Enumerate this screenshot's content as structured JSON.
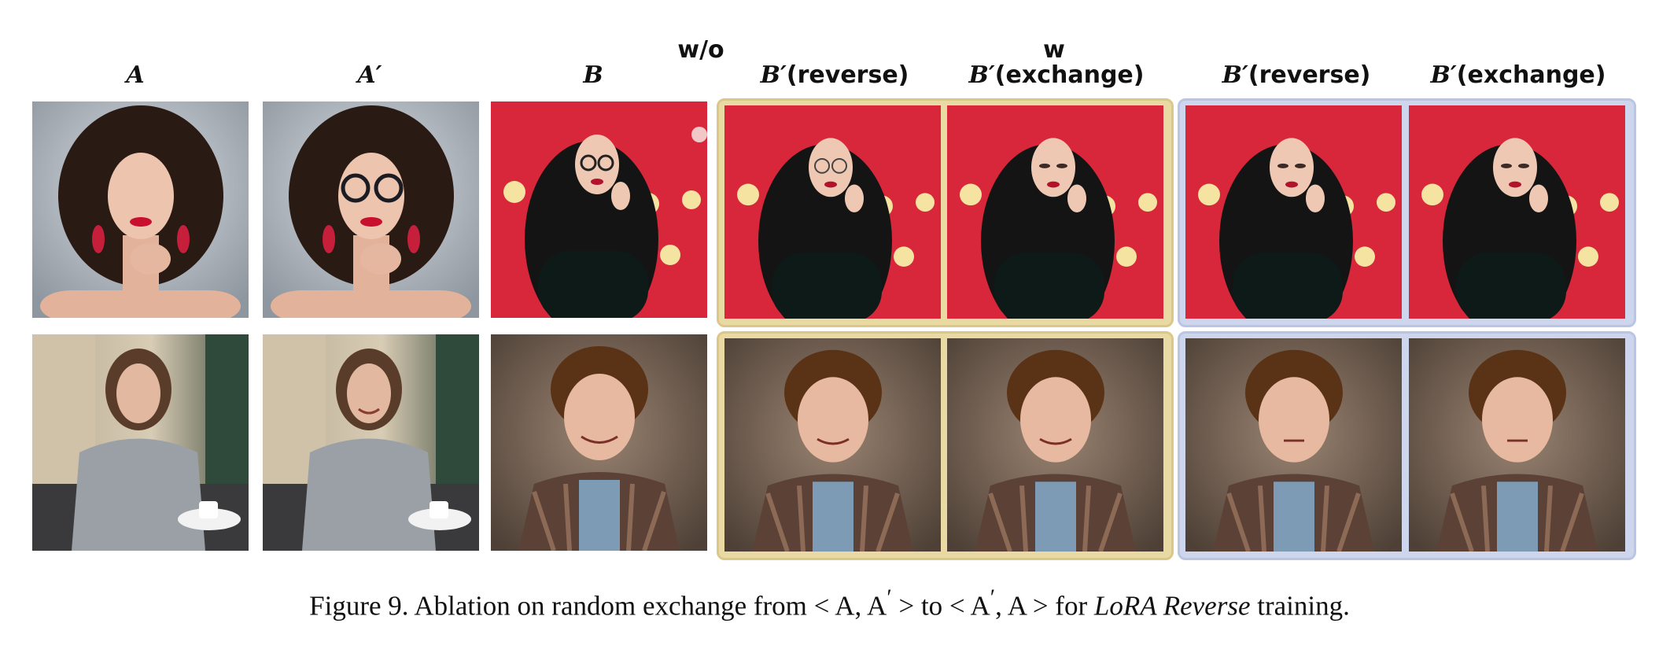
{
  "groups": {
    "without": "w/o",
    "with": "w"
  },
  "columns": {
    "a": "A",
    "a_prime": "A′",
    "b": "B",
    "wo_reverse_sym": "B′",
    "wo_reverse_txt": "(reverse)",
    "wo_exchange_sym": "B′",
    "wo_exchange_txt": "(exchange)",
    "w_reverse_sym": "B′",
    "w_reverse_txt": "(reverse)",
    "w_exchange_sym": "B′",
    "w_exchange_txt": "(exchange)"
  },
  "caption": {
    "prefix": "Figure 9. Ablation on random exchange from < A, A",
    "mid": " > to < A",
    "mid2": ", A > for ",
    "italic": "LoRA Reverse",
    "suffix": " training.",
    "prime": "′"
  },
  "colors": {
    "wo_frame": "#e9d9a3",
    "w_frame": "#cdd6ec",
    "red_bg": "#d8263a",
    "brown_bg": "#6e5a4a"
  }
}
